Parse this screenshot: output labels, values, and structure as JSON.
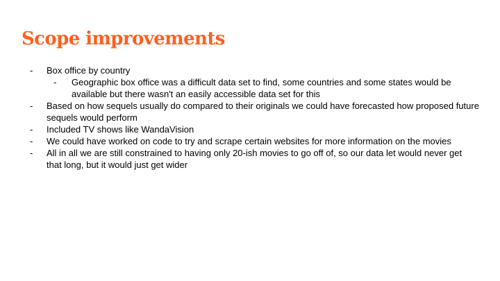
{
  "slide": {
    "title": "Scope improvements",
    "title_color": "#ff5f1f",
    "bullet_marker": "-",
    "bullets": [
      {
        "text": "Box office by country",
        "sub": [
          "Geographic box office was a difficult data set to find, some countries and some states would be available but there wasn't an easily accessible data set for this"
        ]
      },
      {
        "text": "Based on how sequels usually do compared to their originals we could have forecasted how proposed future sequels would perform"
      },
      {
        "text": "Included TV shows like WandaVision"
      },
      {
        "text": "We could have worked on code to try and scrape certain websites for more information on the movies"
      },
      {
        "text": "All in all we are still constrained to having only 20-ish movies to go off of, so our data let would never get that long, but it would just get wider"
      }
    ]
  }
}
